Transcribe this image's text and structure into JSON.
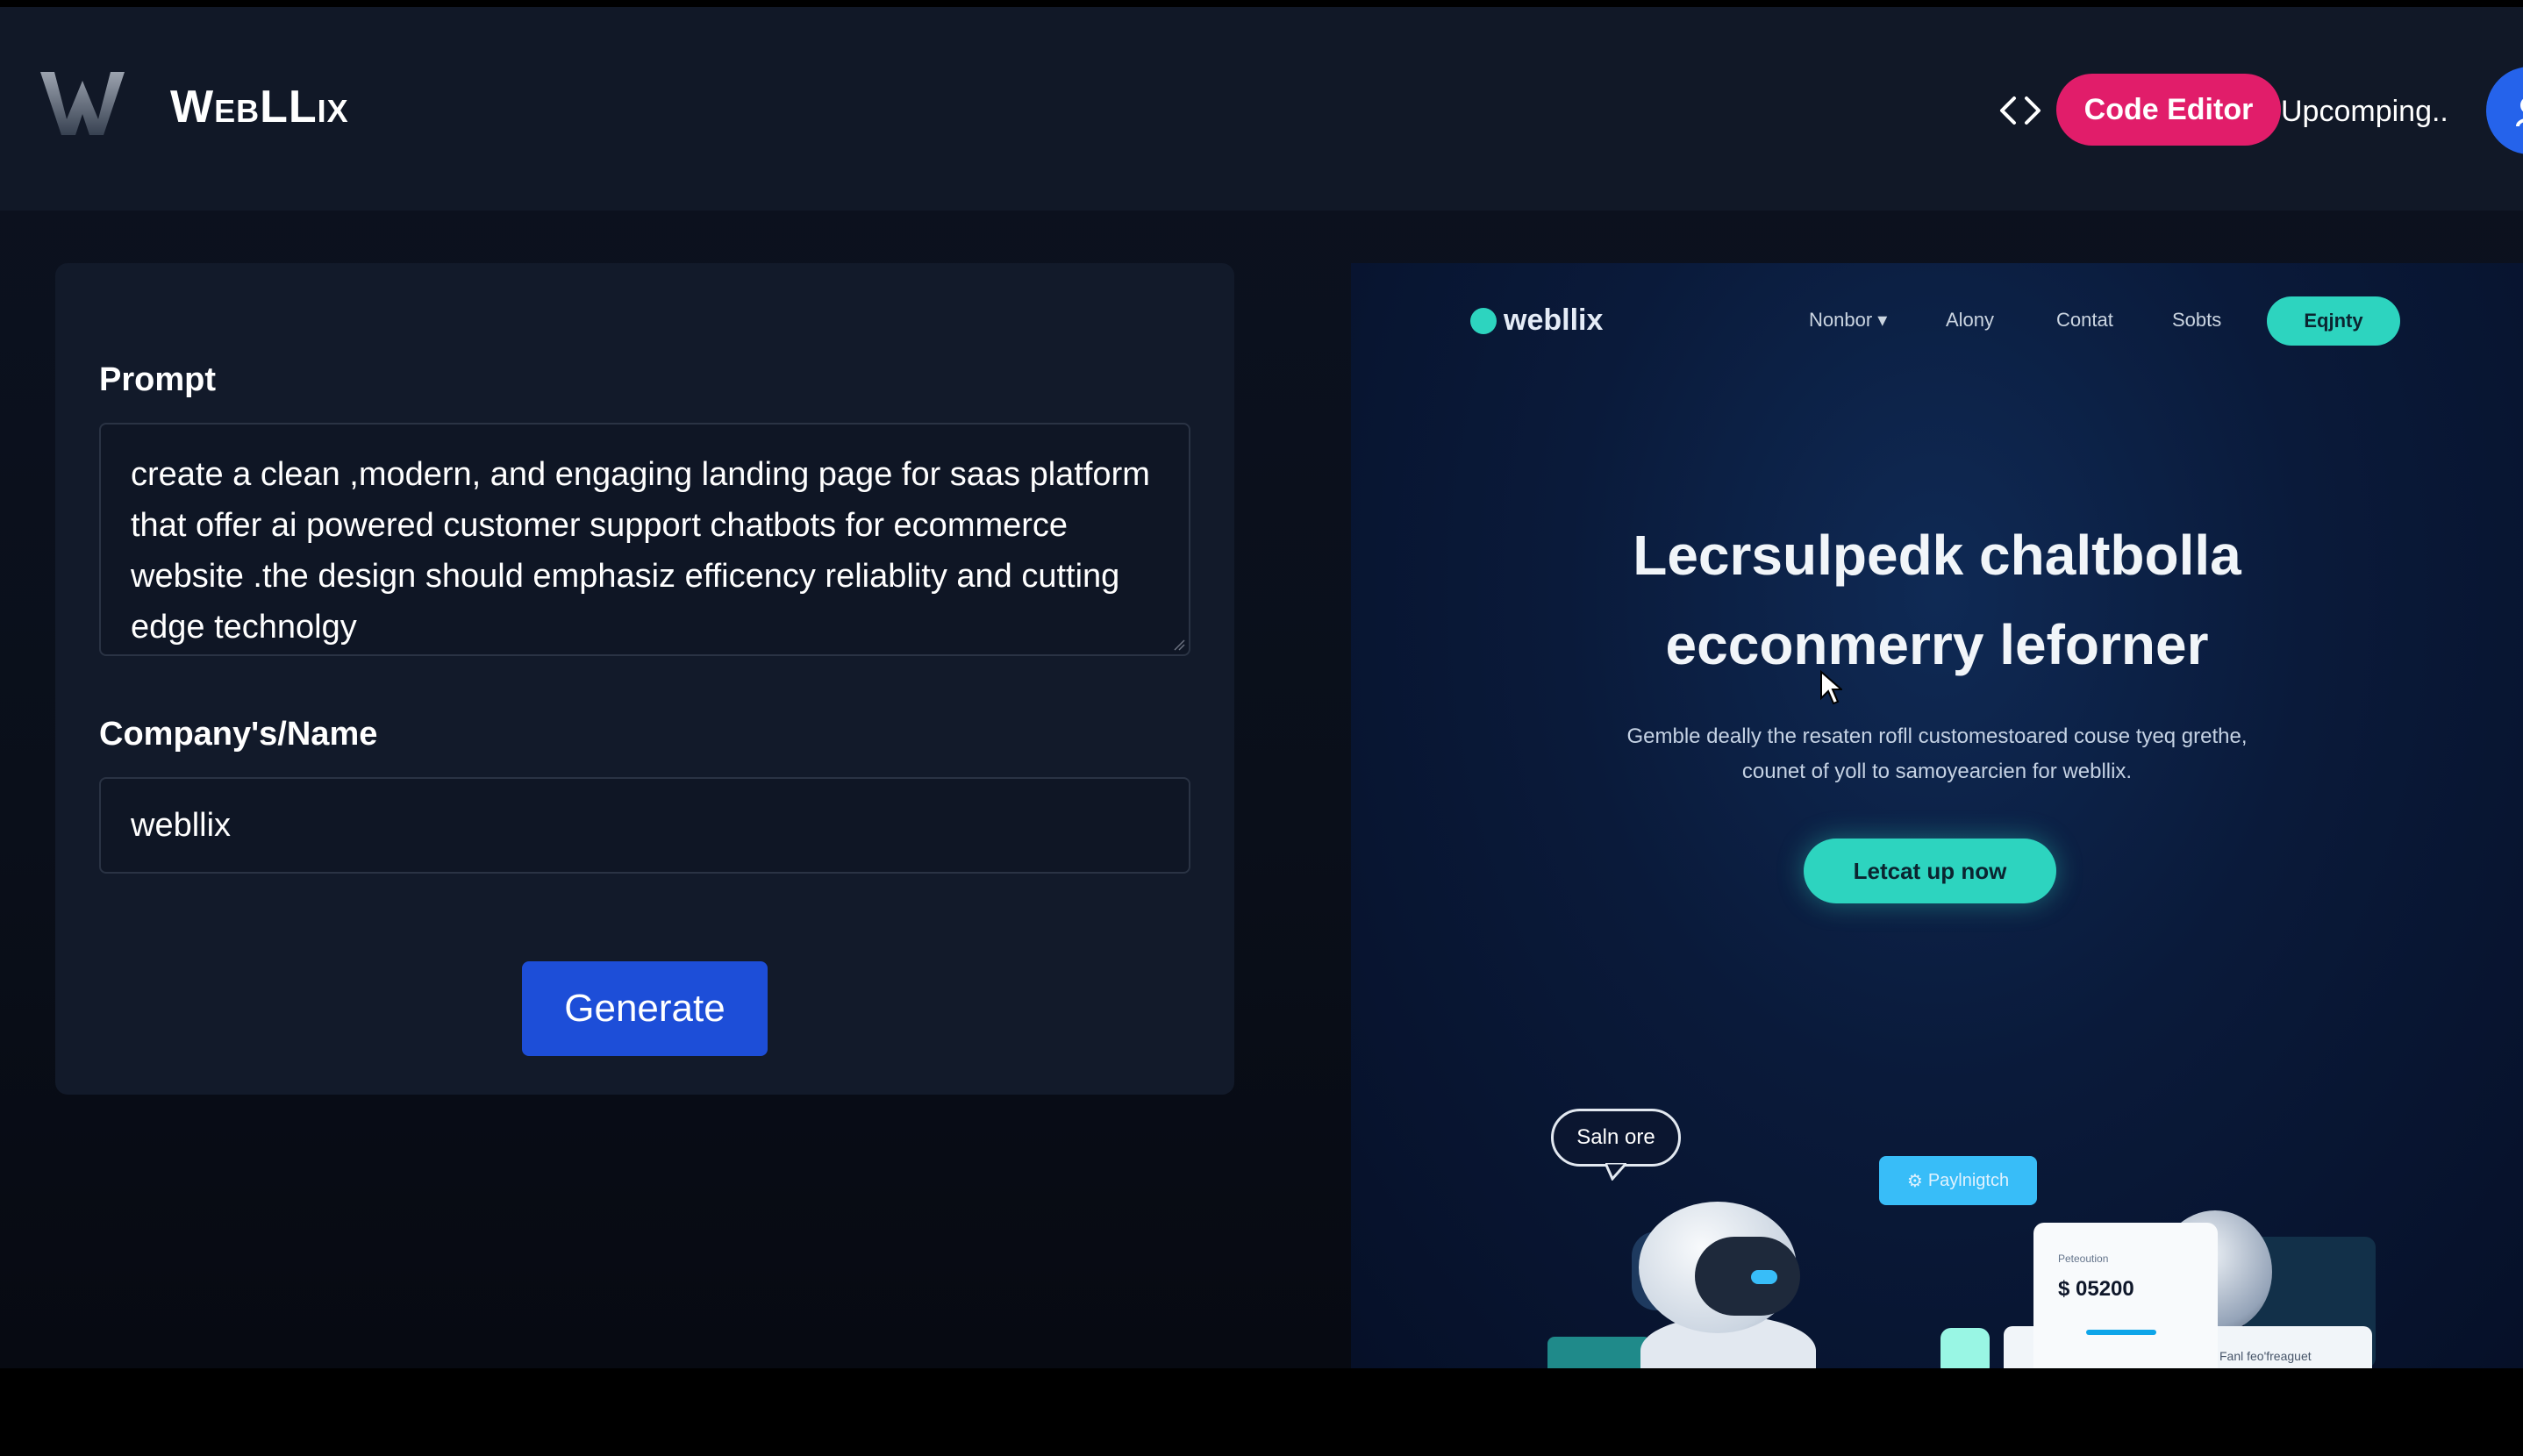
{
  "header": {
    "brand": "WebLLix",
    "code_editor_label": "Code Editor",
    "upcoming_label": "Upcomping.."
  },
  "icons": {
    "logo": "w-logo-icon",
    "code": "code-brackets-icon",
    "avatar": "user-icon"
  },
  "form": {
    "prompt_label": "Prompt",
    "prompt_text": "create  a clean ,modern, and  engaging  landing page for saas platform that offer ai powered  customer support  chatbots for ecommerce website .the design should emphasiz efficency reliablity  and cutting edge technolgy",
    "company_label": "Company's/Name",
    "company_value": "webllix",
    "generate_label": "Generate"
  },
  "preview": {
    "logo_text": "webllix",
    "nav": [
      "Nonbor ▾",
      "Alony",
      "Contat",
      "Sobts"
    ],
    "nav_cta": "Eqjnty",
    "title_line1": "Lecrsulpedk chaltbolla",
    "title_line2": "ecconmerry leforner",
    "subtitle_line1": "Gemble deally the resaten rofll customestoared couse tyeq grethe,",
    "subtitle_line2": "counet of yoll to samoyearcien for webllix.",
    "cta_label": "Letcat up now",
    "bubble_text": "Saln ore",
    "tag_text": "Paylnigtch",
    "card_small": "Peteoution",
    "card_amount": "$ 05200",
    "card_footer": "Fanl feo'freaguet"
  },
  "colors": {
    "code_editor_bg": "#e11d6a",
    "generate_bg": "#1d4ed8",
    "preview_accent": "#2dd4bf",
    "avatar_bg": "#2563eb"
  }
}
